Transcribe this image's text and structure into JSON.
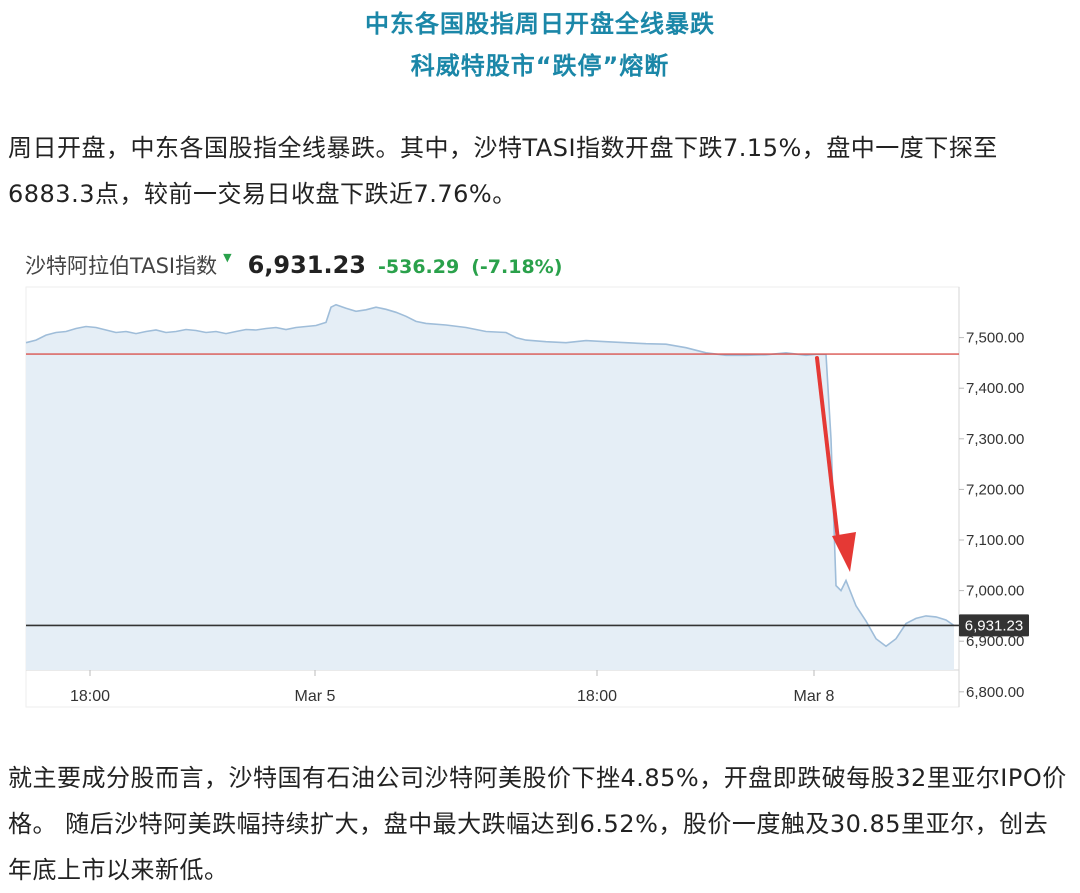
{
  "article": {
    "headline_1": "中东各国股指周日开盘全线暴跌",
    "headline_2": "科威特股市“跌停”熔断",
    "paragraph_1": "周日开盘，中东各国股指全线暴跌。其中，沙特TASI指数开盘下跌7.15%，盘中一度下探至6883.3点，较前一交易日收盘下跌近7.76%。",
    "paragraph_2": "就主要成分股而言，沙特国有石油公司沙特阿美股价下挫4.85%，开盘即跌破每股32里亚尔IPO价格。 随后沙特阿美跌幅持续扩大，盘中最大跌幅达到6.52%，股价一度触及30.85里亚尔，创去年底上市以来新低。"
  },
  "chart_header": {
    "name": "沙特阿拉伯TASI指数",
    "value": "6,931.23",
    "change": "-536.29",
    "change_pct": "(-7.18%)"
  },
  "colors": {
    "headline": "#1b87a8",
    "positive_change": "#2aa14b",
    "area_fill": "#e5eef6",
    "line": "#9fbdd9",
    "prev_close_line": "#d9534f",
    "arrow": "#e53935",
    "current_line": "#333333",
    "label_bg": "#333333"
  },
  "chart_data": {
    "type": "area",
    "ylim": [
      6770,
      7600
    ],
    "y_ticks": [
      7500,
      7400,
      7300,
      7200,
      7100,
      7000,
      6900,
      6800
    ],
    "y_tick_labels": [
      "7,500.00",
      "7,400.00",
      "7,300.00",
      "7,200.00",
      "7,100.00",
      "7,000.00",
      "6,900.00",
      "6,800.00"
    ],
    "x_tick_labels": [
      "18:00",
      "Mar 5",
      "18:00",
      "Mar 8"
    ],
    "reference_lines": {
      "previous_close": 7467.52,
      "current": 6931.23
    },
    "current_label": "6,931.23",
    "series": [
      {
        "x": [
          0,
          10,
          20,
          30,
          40,
          50,
          60,
          70,
          80,
          90,
          100,
          110,
          120,
          130,
          140,
          150,
          160,
          170,
          180,
          190,
          200,
          210,
          220,
          230,
          240,
          250,
          260,
          270,
          280,
          290,
          300,
          305,
          310,
          320,
          330,
          340,
          350,
          360,
          370,
          380,
          390,
          400,
          420,
          440,
          460,
          480,
          490,
          500,
          520,
          540,
          560,
          580,
          600,
          620,
          640,
          660,
          680,
          700,
          720,
          740,
          760,
          780,
          790,
          800,
          805,
          810,
          815,
          820,
          830,
          840,
          850,
          860,
          870,
          880,
          890,
          900,
          910,
          920,
          928
        ],
        "values": [
          7490,
          7495,
          7505,
          7510,
          7512,
          7518,
          7522,
          7520,
          7515,
          7510,
          7512,
          7508,
          7512,
          7515,
          7510,
          7512,
          7516,
          7514,
          7510,
          7512,
          7508,
          7512,
          7516,
          7515,
          7518,
          7520,
          7516,
          7520,
          7522,
          7524,
          7530,
          7560,
          7565,
          7558,
          7552,
          7555,
          7560,
          7556,
          7550,
          7542,
          7532,
          7528,
          7525,
          7520,
          7512,
          7510,
          7500,
          7495,
          7492,
          7490,
          7494,
          7492,
          7490,
          7488,
          7487,
          7480,
          7470,
          7465,
          7465,
          7466,
          7470,
          7465,
          7467,
          7467,
          7300,
          7010,
          7000,
          7020,
          6970,
          6940,
          6905,
          6890,
          6905,
          6935,
          6945,
          6950,
          6948,
          6942,
          6931
        ]
      }
    ]
  }
}
